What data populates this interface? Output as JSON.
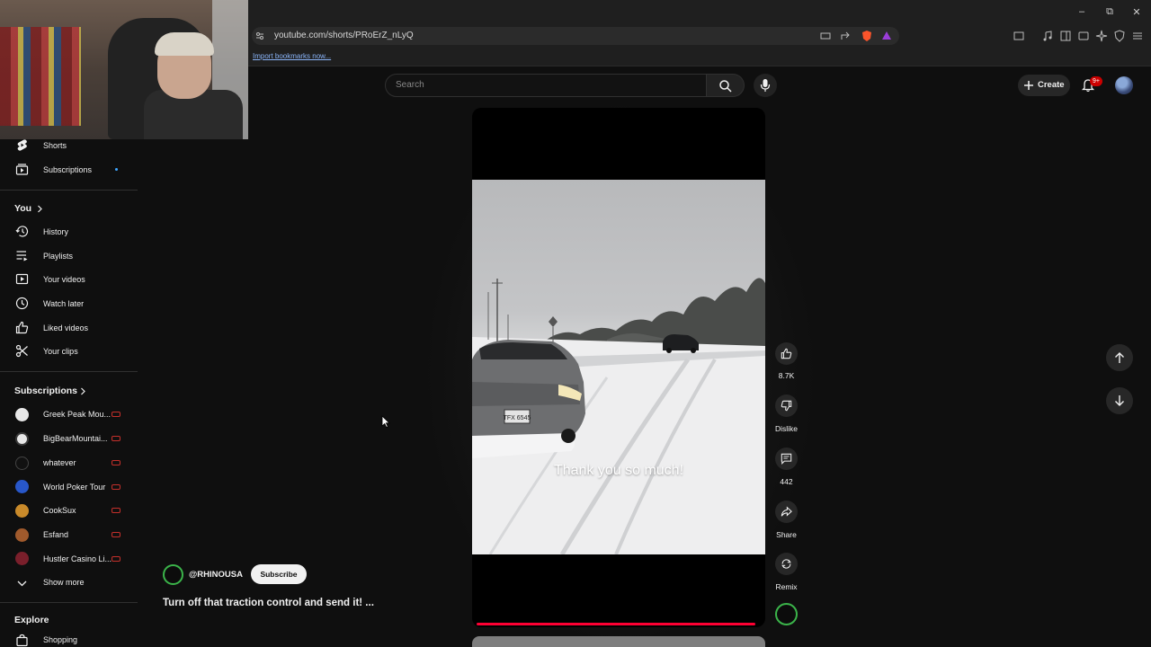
{
  "browser": {
    "url": "youtube.com/shorts/PRoErZ_nLyQ",
    "bookmark_link": "Import bookmarks now..."
  },
  "masthead": {
    "search_placeholder": "Search",
    "create_label": "Create",
    "notification_badge": "9+"
  },
  "sidebar": {
    "top_items": [
      {
        "label": "Shorts",
        "icon": "shorts-icon"
      },
      {
        "label": "Subscriptions",
        "icon": "subscriptions-icon"
      }
    ],
    "you_heading": "You",
    "you_items": [
      {
        "label": "History",
        "icon": "history-icon"
      },
      {
        "label": "Playlists",
        "icon": "playlists-icon"
      },
      {
        "label": "Your videos",
        "icon": "your-videos-icon"
      },
      {
        "label": "Watch later",
        "icon": "clock-icon"
      },
      {
        "label": "Liked videos",
        "icon": "thumbs-up-icon"
      },
      {
        "label": "Your clips",
        "icon": "scissors-icon"
      }
    ],
    "subscriptions_heading": "Subscriptions",
    "subscriptions": [
      {
        "label": "Greek Peak Mou...",
        "avatar_color": "#e8e8e8"
      },
      {
        "label": "BigBearMountai...",
        "avatar_color": "#e8e8e8"
      },
      {
        "label": "whatever",
        "avatar_color": "#111111"
      },
      {
        "label": "World Poker Tour",
        "avatar_color": "#2857c9"
      },
      {
        "label": "CookSux",
        "avatar_color": "#c98a2a"
      },
      {
        "label": "Esfand",
        "avatar_color": "#a05a2c"
      },
      {
        "label": "Hustler Casino Li...",
        "avatar_color": "#7a1f2b"
      }
    ],
    "show_more": "Show more",
    "explore_heading": "Explore",
    "explore_items": [
      {
        "label": "Shopping",
        "icon": "shopping-bag-icon"
      }
    ]
  },
  "short": {
    "caption": "Thank you so much!",
    "channel": "@RHINOUSA",
    "subscribe_label": "Subscribe",
    "title": "Turn off that traction control and send it! ...",
    "progress": 0.98
  },
  "actions": {
    "like_count": "8.7K",
    "dislike_label": "Dislike",
    "comment_count": "442",
    "share_label": "Share",
    "remix_label": "Remix"
  },
  "colors": {
    "accent_red": "#ff0033",
    "background": "#0f0f0f",
    "live_indicator": "#c4302b"
  }
}
